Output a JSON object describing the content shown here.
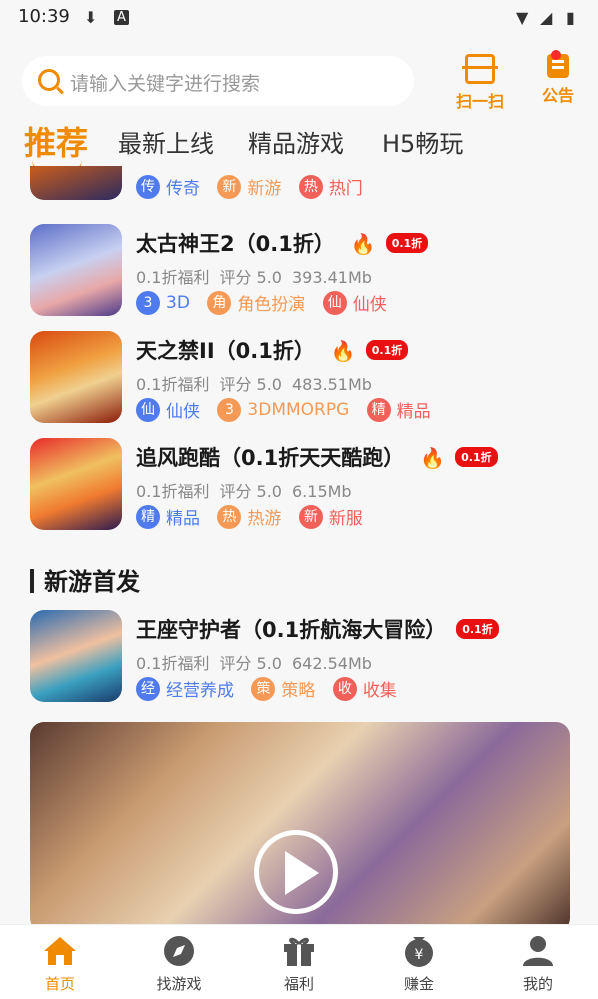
{
  "status_bar": {
    "time": "10:39"
  },
  "search": {
    "placeholder": "请输入关键字进行搜索"
  },
  "header_actions": {
    "scan_label": "扫一扫",
    "notice_label": "公告"
  },
  "tabs": [
    {
      "label": "推荐",
      "active": true
    },
    {
      "label": "最新上线"
    },
    {
      "label": "精品游戏"
    },
    {
      "label": "H5畅玩"
    }
  ],
  "games": [
    {
      "tags": [
        {
          "badge": "传",
          "label": "传奇",
          "color": "#4f7bef"
        },
        {
          "badge": "新",
          "label": "新游",
          "color": "#f59a56"
        },
        {
          "badge": "热",
          "label": "热门",
          "color": "#f2605a"
        }
      ]
    },
    {
      "title": "太古神王2（0.1折）",
      "discount": "0.1折",
      "benefit": "0.1折福利",
      "rating": "评分 5.0",
      "size": "393.41Mb",
      "tags": [
        {
          "badge": "3",
          "label": "3D",
          "color": "#4f7bef"
        },
        {
          "badge": "角",
          "label": "角色扮演",
          "color": "#f59a56"
        },
        {
          "badge": "仙",
          "label": "仙侠",
          "color": "#f2605a"
        }
      ]
    },
    {
      "title": "天之禁II（0.1折）",
      "discount": "0.1折",
      "benefit": "0.1折福利",
      "rating": "评分 5.0",
      "size": "483.51Mb",
      "tags": [
        {
          "badge": "仙",
          "label": "仙侠",
          "color": "#4f7bef"
        },
        {
          "badge": "3",
          "label": "3DMMORPG",
          "color": "#f59a56"
        },
        {
          "badge": "精",
          "label": "精品",
          "color": "#f2605a"
        }
      ]
    },
    {
      "title": "追风跑酷（0.1折天天酷跑）",
      "discount": "0.1折",
      "benefit": "0.1折福利",
      "rating": "评分 5.0",
      "size": "6.15Mb",
      "tags": [
        {
          "badge": "精",
          "label": "精品",
          "color": "#4f7bef"
        },
        {
          "badge": "热",
          "label": "热游",
          "color": "#f59a56"
        },
        {
          "badge": "新",
          "label": "新服",
          "color": "#f2605a"
        }
      ]
    }
  ],
  "section": {
    "title": "新游首发"
  },
  "featured": {
    "title": "王座守护者（0.1折航海大冒险）",
    "discount": "0.1折",
    "benefit": "0.1折福利",
    "rating": "评分 5.0",
    "size": "642.54Mb",
    "tags": [
      {
        "badge": "经",
        "label": "经营养成",
        "color": "#4f7bef"
      },
      {
        "badge": "策",
        "label": "策略",
        "color": "#f59a56"
      },
      {
        "badge": "收",
        "label": "收集",
        "color": "#f2605a"
      }
    ]
  },
  "bottom_nav": [
    {
      "label": "首页",
      "active": true
    },
    {
      "label": "找游戏"
    },
    {
      "label": "福利"
    },
    {
      "label": "赚金"
    },
    {
      "label": "我的"
    }
  ]
}
